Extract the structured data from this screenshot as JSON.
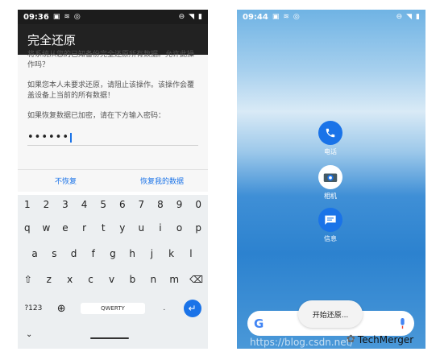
{
  "left_phone": {
    "status": {
      "time": "09:36"
    },
    "app_title": "完全还原",
    "dialog": {
      "cut_text": "将系统从您的已知备份完全还原所有数据。允许此操作吗？",
      "para1": "如果您本人未要求还原，请阻止该操作。该操作会覆盖设备上当前的所有数据！",
      "para2": "如果恢复数据已加密，请在下方输入密码：",
      "password_value": "••••••"
    },
    "actions": {
      "deny": "不恢复",
      "confirm": "恢复我的数据"
    },
    "keyboard": {
      "row1": [
        "1",
        "2",
        "3",
        "4",
        "5",
        "6",
        "7",
        "8",
        "9",
        "0"
      ],
      "row2": [
        "q",
        "w",
        "e",
        "r",
        "t",
        "y",
        "u",
        "i",
        "o",
        "p"
      ],
      "row3": [
        "a",
        "s",
        "d",
        "f",
        "g",
        "h",
        "j",
        "k",
        "l"
      ],
      "row4": [
        "z",
        "x",
        "c",
        "v",
        "b",
        "n",
        "m"
      ],
      "symbols_key": "?123",
      "space_label": "QWERTY",
      "period_key": "."
    }
  },
  "right_phone": {
    "status": {
      "time": "09:44"
    },
    "apps": [
      {
        "label": "电话",
        "icon": "phone-icon",
        "color": "#1a73e8"
      },
      {
        "label": "相机",
        "icon": "camera-icon",
        "color": "#ffffff"
      },
      {
        "label": "信息",
        "icon": "messages-icon",
        "color": "#1a73e8"
      }
    ],
    "toast": "开始还原..."
  },
  "watermark": {
    "url": "https://blog.csdn.net/",
    "brand": "TechMerger"
  },
  "colors": {
    "accent": "#1a73e8",
    "appbar": "#222222"
  }
}
